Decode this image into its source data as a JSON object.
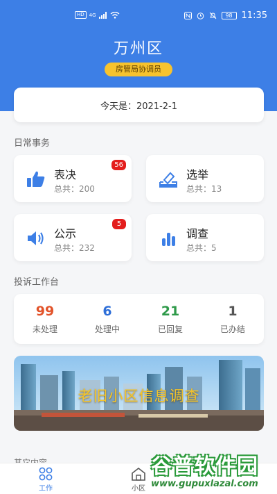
{
  "status_bar": {
    "left_chips": [
      "HD",
      "4G"
    ],
    "battery": "98",
    "time": "11:35"
  },
  "header": {
    "district": "万州区",
    "role": "房管局协调员"
  },
  "date_card": {
    "label": "今天是：2021-2-1"
  },
  "daily_section": {
    "title": "日常事务",
    "items": [
      {
        "name": "表决",
        "count": "总共：200",
        "badge": "56",
        "icon": "thumbs-up-icon"
      },
      {
        "name": "选举",
        "count": "总共：13",
        "badge": null,
        "icon": "ballot-icon"
      },
      {
        "name": "公示",
        "count": "总共：232",
        "badge": "5",
        "icon": "speaker-icon"
      },
      {
        "name": "调查",
        "count": "总共：5",
        "badge": null,
        "icon": "bar-chart-icon"
      }
    ]
  },
  "complaint_section": {
    "title": "投诉工作台",
    "stats": [
      {
        "value": "99",
        "label": "未处理",
        "color": "#e2532a"
      },
      {
        "value": "6",
        "label": "处理中",
        "color": "#2f6fd8"
      },
      {
        "value": "21",
        "label": "已回复",
        "color": "#2f9a4a"
      },
      {
        "value": "1",
        "label": "已办结",
        "color": "#555555"
      }
    ]
  },
  "banner": {
    "text": "老旧小区信息调查"
  },
  "other_section": {
    "title": "其它内容"
  },
  "tab_bar": {
    "tabs": [
      {
        "label": "工作",
        "active": true
      },
      {
        "label": "小区",
        "active": false
      }
    ]
  },
  "watermark": {
    "main": "谷普软件园",
    "sub": "www.gupuxlazal.com"
  },
  "colors": {
    "primary": "#3d7fe6",
    "badge": "#e31d1c",
    "role_badge": "#f7c32e"
  }
}
